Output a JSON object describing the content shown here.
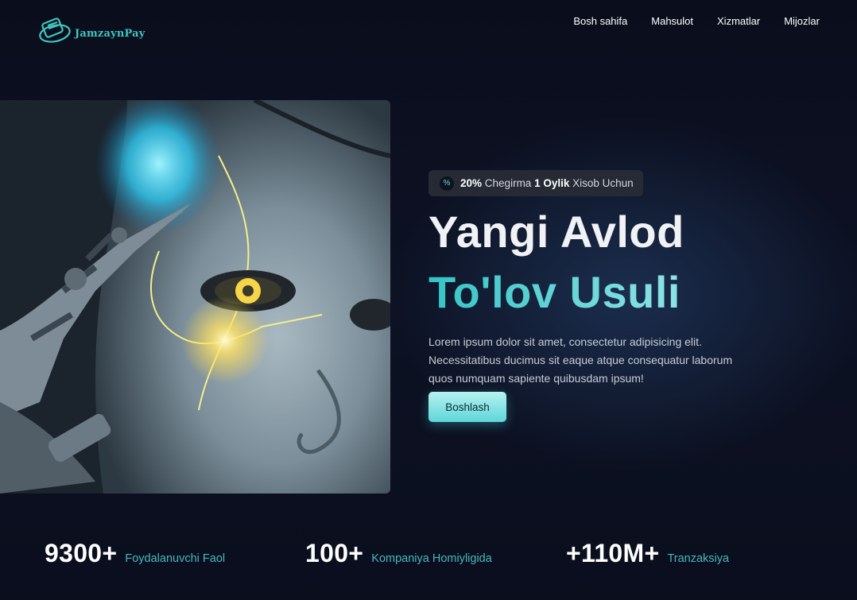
{
  "brand": {
    "name": "JamzaynPay",
    "accent": "#3fc6c1"
  },
  "nav": {
    "items": [
      {
        "label": "Bosh sahifa"
      },
      {
        "label": "Mahsulot"
      },
      {
        "label": "Xizmatlar"
      },
      {
        "label": "Mijozlar"
      }
    ]
  },
  "hero": {
    "badge": {
      "icon": "percent-icon",
      "percent": "20%",
      "word1": "Chegirma",
      "months": "1 Oylik",
      "word2": "Xisob Uchun"
    },
    "title_line1": "Yangi Avlod",
    "title_line2": "To'lov Usuli",
    "description": "Lorem ipsum dolor sit amet, consectetur adipisicing elit. Necessitatibus ducimus sit eaque atque consequatur laborum quos numquam sapiente quibusdam ipsum!",
    "cta_label": "Boshlash",
    "image": "robot-face-image"
  },
  "stats": [
    {
      "value": "9300+",
      "label": "Foydalanuvchi Faol"
    },
    {
      "value": "100+",
      "label": "Kompaniya Homiyligida"
    },
    {
      "value": "+110M+",
      "label": "Tranzaksiya"
    }
  ],
  "colors": {
    "background": "#0b0f1e",
    "accent_text": "#45b9bd",
    "cta": "#5fd6d8"
  }
}
